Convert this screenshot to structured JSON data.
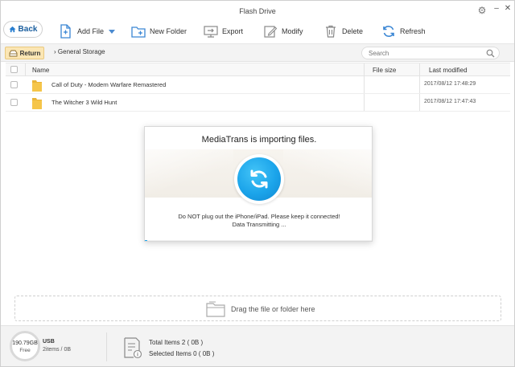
{
  "window": {
    "title": "Flash Drive"
  },
  "toolbar": {
    "back_label": "Back",
    "add_file_label": "Add File",
    "new_folder_label": "New Folder",
    "export_label": "Export",
    "modify_label": "Modify",
    "delete_label": "Delete",
    "refresh_label": "Refresh"
  },
  "nav": {
    "return_label": "Return",
    "breadcrumb": "General Storage",
    "search_placeholder": "Search"
  },
  "table": {
    "columns": {
      "name": "Name",
      "size": "File size",
      "modified": "Last modified"
    },
    "rows": [
      {
        "name": "Call of Duty - Modern Warfare Remastered",
        "size": "",
        "modified": "2017/08/12 17:48:29"
      },
      {
        "name": "The Witcher 3 Wild Hunt",
        "size": "",
        "modified": "2017/08/12 17:47:43"
      }
    ]
  },
  "dialog": {
    "title": "MediaTrans is importing files.",
    "message": "Do NOT plug out the iPhone/iPad. Please keep it connected!",
    "status": "Data Transmitting ...",
    "progress": 0.01,
    "accent": "#1ba4ea"
  },
  "dropzone": {
    "label": "Drag the file or folder here"
  },
  "footer": {
    "free_space": "190.79GB",
    "free_label": "Free",
    "device_label": "USB",
    "device_items": "2items / 0B",
    "total_items": "Total Items 2 ( 0B )",
    "selected_items": "Selected Items 0 ( 0B )"
  }
}
